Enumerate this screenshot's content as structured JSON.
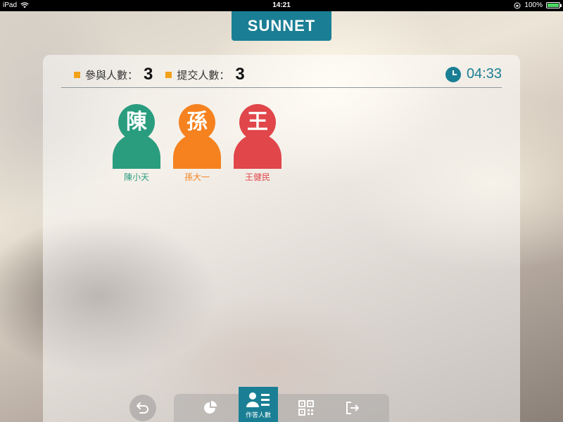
{
  "status_bar": {
    "device": "iPad",
    "time": "14:21",
    "battery_text": "100%",
    "battery_level": 1.0
  },
  "logo": {
    "text": "SUNNET"
  },
  "stats": {
    "participants_label": "參與人數：",
    "participants_value": "3",
    "submitted_label": "提交人數：",
    "submitted_value": "3",
    "timer": "04:33"
  },
  "students": [
    {
      "initial": "陳",
      "name": "陳小天",
      "color": "#2a9d7f"
    },
    {
      "initial": "孫",
      "name": "孫大一",
      "color": "#f5821f"
    },
    {
      "initial": "王",
      "name": "王健民",
      "color": "#e0464a"
    }
  ],
  "toolbar": {
    "back_icon": "undo-arrow-icon",
    "chart_icon": "pie-chart-icon",
    "respondents_icon": "user-list-icon",
    "respondents_label": "作答人數",
    "qr_icon": "qr-code-icon",
    "exit_icon": "exit-icon"
  },
  "colors": {
    "accent": "#1a7f94",
    "stat_marker": "#f2a21a"
  }
}
